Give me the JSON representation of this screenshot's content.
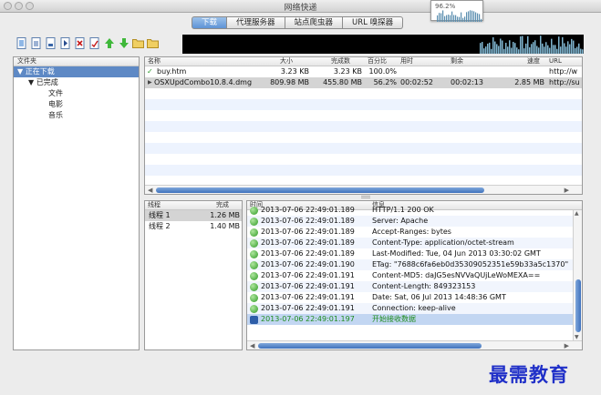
{
  "window": {
    "title": "网络快递"
  },
  "meter": {
    "value": "96.2%"
  },
  "tabs": [
    "下载",
    "代理服务器",
    "站点爬虫器",
    "URL 嗅探器"
  ],
  "toolbar": {
    "buttons": [
      "new-download-icon",
      "import-icon",
      "page-icon",
      "start-icon",
      "stop-icon",
      "edit-icon",
      "move-up-icon",
      "move-down-icon",
      "open-folder-icon",
      "folder-icon"
    ]
  },
  "sidebar": {
    "header": "文件夹",
    "items": [
      {
        "label": "正在下载",
        "level": 0,
        "expanded": true,
        "selected": true
      },
      {
        "label": "已完成",
        "level": 1,
        "expanded": true,
        "selected": false
      },
      {
        "label": "文件",
        "level": 2,
        "selected": false
      },
      {
        "label": "电影",
        "level": 2,
        "selected": false
      },
      {
        "label": "音乐",
        "level": 2,
        "selected": false
      }
    ]
  },
  "filelist": {
    "columns": [
      "名称",
      "大小",
      "完成数",
      "百分比",
      "用时",
      "剩余",
      "速度",
      "URL"
    ],
    "rows": [
      {
        "icon": "check-icon",
        "name": "buy.htm",
        "size": "3.23 KB",
        "done": "3.23 KB",
        "percent": "100.0%",
        "elapsed": "",
        "remaining": "",
        "speed": "",
        "url": "http://w"
      },
      {
        "icon": "play-icon",
        "name": "OSXUpdCombo10.8.4.dmg",
        "size": "809.98 MB",
        "done": "455.80 MB",
        "percent": "56.2%",
        "elapsed": "00:02:52",
        "remaining": "00:02:13",
        "speed": "2.85 MB",
        "url": "http://su"
      }
    ]
  },
  "threads": {
    "columns": [
      "线程",
      "完成"
    ],
    "rows": [
      {
        "name": "线程 1",
        "done": "1.26 MB"
      },
      {
        "name": "线程 2",
        "done": "1.40 MB"
      }
    ]
  },
  "log": {
    "columns": [
      "时间",
      "信息"
    ],
    "rows": [
      {
        "time": "2013-07-06 22:49:01.189",
        "msg": "HTTP/1.1 200 OK"
      },
      {
        "time": "2013-07-06 22:49:01.189",
        "msg": "Server: Apache"
      },
      {
        "time": "2013-07-06 22:49:01.189",
        "msg": "Accept-Ranges: bytes"
      },
      {
        "time": "2013-07-06 22:49:01.189",
        "msg": "Content-Type: application/octet-stream"
      },
      {
        "time": "2013-07-06 22:49:01.189",
        "msg": "Last-Modified: Tue, 04 Jun 2013 03:30:02 GMT"
      },
      {
        "time": "2013-07-06 22:49:01.190",
        "msg": "ETag: \"7688c6fa6eb0d35309052351e59b33a5c1370\""
      },
      {
        "time": "2013-07-06 22:49:01.191",
        "msg": "Content-MD5: daJG5esNVVaQUjLeWoMEXA=="
      },
      {
        "time": "2013-07-06 22:49:01.191",
        "msg": "Content-Length: 849323153"
      },
      {
        "time": "2013-07-06 22:49:01.191",
        "msg": "Date: Sat, 06 Jul 2013 14:48:36 GMT"
      },
      {
        "time": "2013-07-06 22:49:01.191",
        "msg": "Connection: keep-alive"
      },
      {
        "time": "2013-07-06 22:49:01.197",
        "msg": "开始接收数据"
      }
    ]
  },
  "watermark": "最需教育",
  "colors": {
    "accent": "#5e89c5",
    "scroll": "#3f72bd",
    "log_highlight": "#1e8c1e"
  }
}
